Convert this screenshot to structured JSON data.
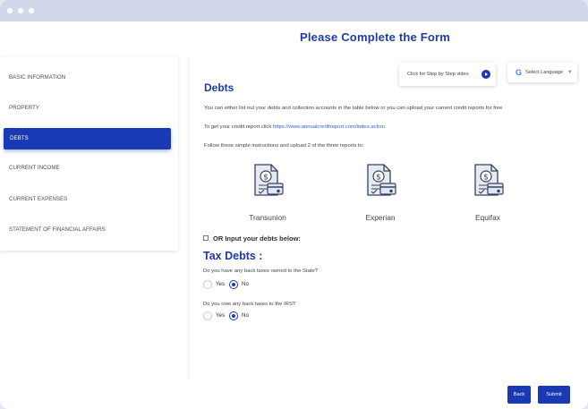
{
  "header": {
    "title": "Please Complete the Form"
  },
  "sidebar": {
    "items": [
      {
        "label": "BASIC INFORMATION"
      },
      {
        "label": "PROPERTY"
      },
      {
        "label": "DEBTS"
      },
      {
        "label": "CURRENT INCOME"
      },
      {
        "label": "CURRENT EXPENSES"
      },
      {
        "label": "STATEMENT OF FINANCIAL AFFAIRS"
      }
    ],
    "active_index": 2
  },
  "toolbar": {
    "video_label": "Click for Step by Step video",
    "language_label": "Select Language",
    "language_caret": "▼"
  },
  "debts": {
    "title": "Debts",
    "intro": "You can either list out your debts and collection accounts in the table below or you can upload your current credit reports for free",
    "credit_text": "To get your credit report click ",
    "credit_link": "https://www.annualcreditreport.com/index.action",
    "instructions": "Follow these simple instructions and upload 2 of the three reports to:",
    "reports": [
      {
        "label": "Transunion",
        "icon": "credit-report-icon"
      },
      {
        "label": "Experian",
        "icon": "credit-report-icon"
      },
      {
        "label": "Equifax",
        "icon": "credit-report-icon"
      }
    ],
    "manual_checkbox_label": "OR Input your debts below:",
    "manual_checked": false
  },
  "tax": {
    "title": "Tax Debts :",
    "questions": [
      {
        "question": "Do you have any back taxes owned to the State?",
        "yes": "Yes",
        "no": "No",
        "selected": "No"
      },
      {
        "question": "Do you owe any back taxes to the IRS?",
        "yes": "Yes",
        "no": "No",
        "selected": "No"
      }
    ]
  },
  "footer": {
    "back_label": "Back",
    "submit_label": "Submit"
  },
  "colors": {
    "accent": "#1a3ab5",
    "title": "#1e3ba6",
    "link": "#2f63d6",
    "titlebar": "#d2d8ec"
  }
}
